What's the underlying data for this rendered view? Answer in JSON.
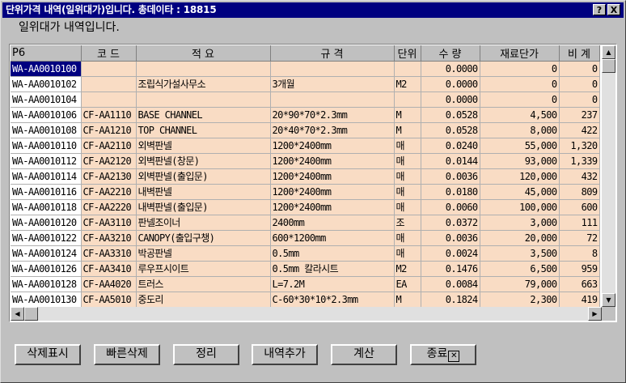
{
  "window": {
    "title": "단위가격 내역(일위대가)입니다.  총데이타 : 18815",
    "help_label": "?",
    "close_label": "X"
  },
  "subtitle": "일위대가 내역입니다.",
  "table": {
    "columns": [
      "P6",
      "코  드",
      "적   요",
      "규   격",
      "단위",
      "수  량",
      "재료단가",
      "비 계"
    ],
    "rows": [
      [
        "WA-AA0010100",
        "",
        "",
        "",
        "",
        "0.0000",
        "0",
        "0"
      ],
      [
        "WA-AA0010102",
        "",
        "조립식가설사무소",
        "3개월",
        "M2",
        "0.0000",
        "0",
        "0"
      ],
      [
        "WA-AA0010104",
        "",
        "",
        "",
        "",
        "0.0000",
        "0",
        "0"
      ],
      [
        "WA-AA0010106",
        "CF-AA1110",
        "BASE CHANNEL",
        "20*90*70*2.3mm",
        "M",
        "0.0528",
        "4,500",
        "237"
      ],
      [
        "WA-AA0010108",
        "CF-AA1210",
        "TOP CHANNEL",
        "20*40*70*2.3mm",
        "M",
        "0.0528",
        "8,000",
        "422"
      ],
      [
        "WA-AA0010110",
        "CF-AA2110",
        "외벽판넬",
        "1200*2400mm",
        "매",
        "0.0240",
        "55,000",
        "1,320"
      ],
      [
        "WA-AA0010112",
        "CF-AA2120",
        "외벽판넬(창문)",
        "1200*2400mm",
        "매",
        "0.0144",
        "93,000",
        "1,339"
      ],
      [
        "WA-AA0010114",
        "CF-AA2130",
        "외벽판넬(출입문)",
        "1200*2400mm",
        "매",
        "0.0036",
        "120,000",
        "432"
      ],
      [
        "WA-AA0010116",
        "CF-AA2210",
        "내벽판넬",
        "1200*2400mm",
        "매",
        "0.0180",
        "45,000",
        "809"
      ],
      [
        "WA-AA0010118",
        "CF-AA2220",
        "내벽판넬(출입문)",
        "1200*2400mm",
        "매",
        "0.0060",
        "100,000",
        "600"
      ],
      [
        "WA-AA0010120",
        "CF-AA3110",
        "판넬조이너",
        "2400mm",
        "조",
        "0.0372",
        "3,000",
        "111"
      ],
      [
        "WA-AA0010122",
        "CF-AA3210",
        "CANOPY(출입구챙)",
        "600*1200mm",
        "매",
        "0.0036",
        "20,000",
        "72"
      ],
      [
        "WA-AA0010124",
        "CF-AA3310",
        "박공판넬",
        "0.5mm",
        "매",
        "0.0024",
        "3,500",
        "8"
      ],
      [
        "WA-AA0010126",
        "CF-AA3410",
        "루우프시이트",
        "0.5mm 칼라시트",
        "M2",
        "0.1476",
        "6,500",
        "959"
      ],
      [
        "WA-AA0010128",
        "CF-AA4020",
        "트러스",
        "L=7.2M",
        "EA",
        "0.0084",
        "79,000",
        "663"
      ],
      [
        "WA-AA0010130",
        "CF-AA5010",
        "중도리",
        "C-60*30*10*2.3mm",
        "M",
        "0.1824",
        "2,300",
        "419"
      ]
    ]
  },
  "buttons": {
    "delete_mark": "삭제표시",
    "quick_delete": "빠른삭제",
    "arrange": "정리",
    "add_item": "내역추가",
    "calculate": "계산",
    "exit": "종료"
  },
  "icons": {
    "exit": "close-box-icon",
    "up": "arrow-up-icon",
    "down": "arrow-down-icon",
    "left": "arrow-left-icon",
    "right": "arrow-right-icon"
  },
  "colors": {
    "titlebar": "#000080",
    "cell_background": "#f9dcc4",
    "selection": "#000080"
  }
}
